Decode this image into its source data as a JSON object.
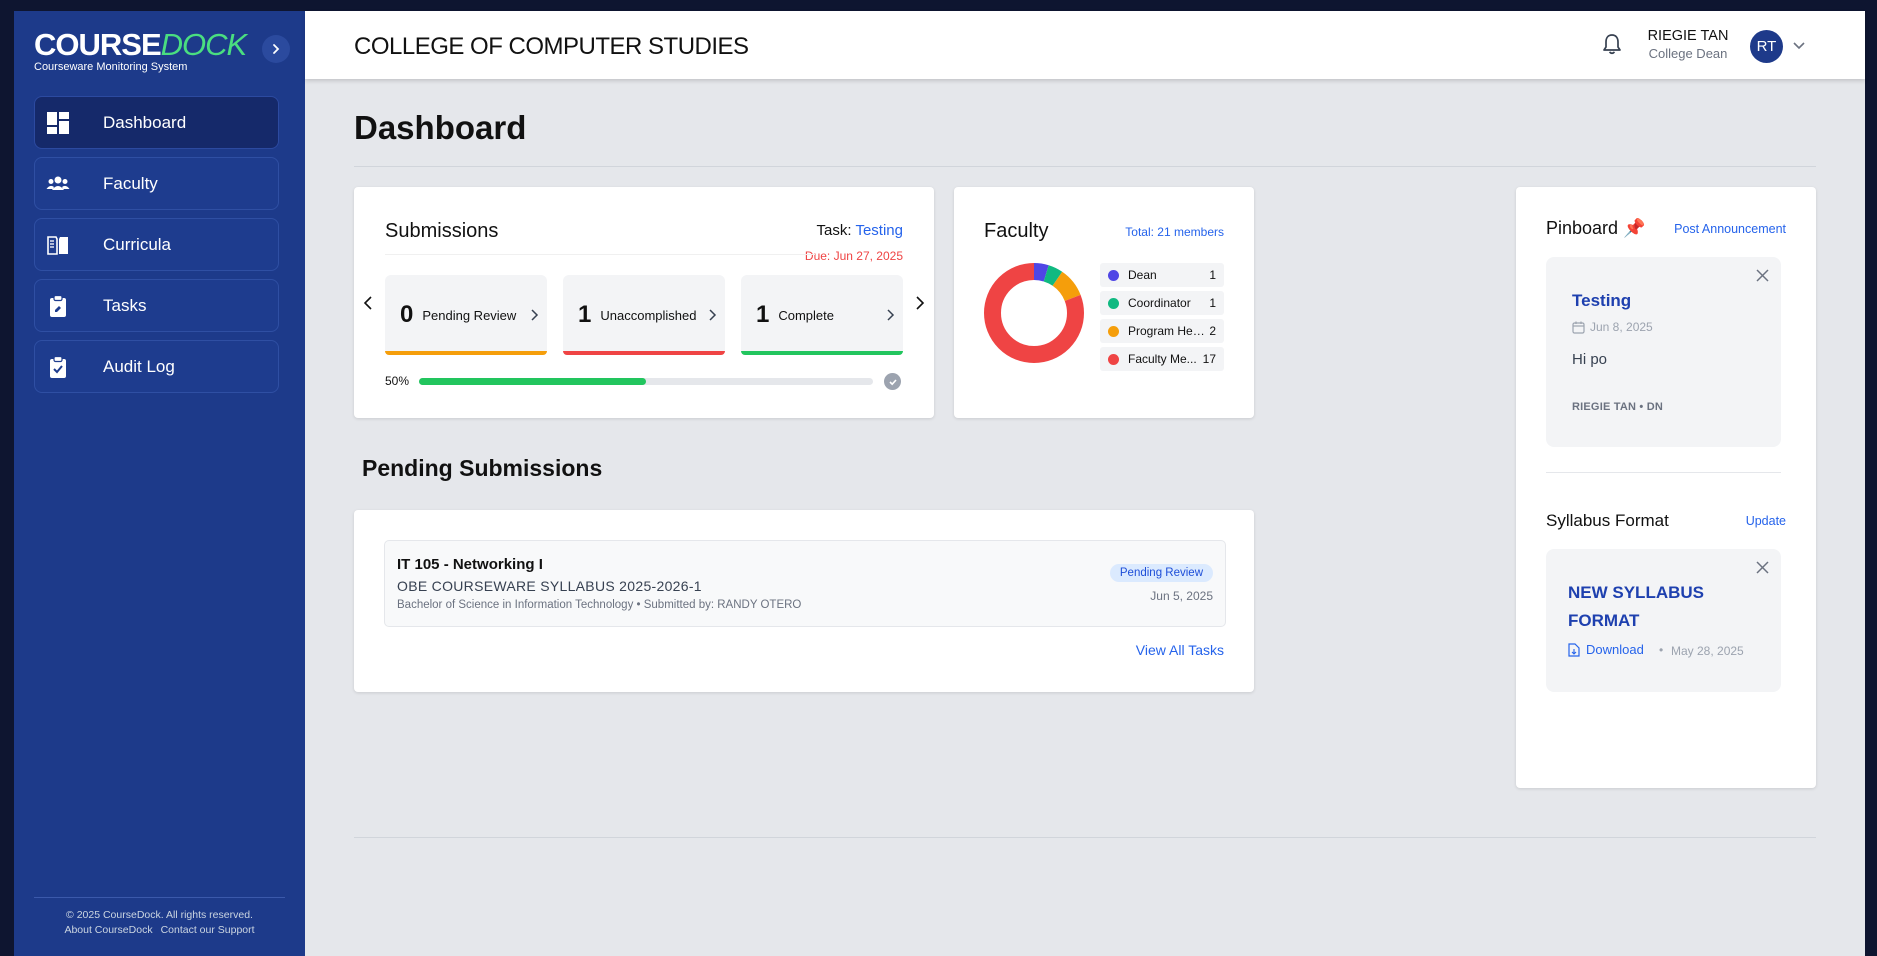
{
  "app": {
    "logo_course": "COURSE",
    "logo_dock": "DOCK",
    "logo_subtitle": "Courseware Monitoring System"
  },
  "sidebar": {
    "items": [
      {
        "label": "Dashboard",
        "icon": "dashboard-icon",
        "active": true
      },
      {
        "label": "Faculty",
        "icon": "users-icon",
        "active": false
      },
      {
        "label": "Curricula",
        "icon": "book-icon",
        "active": false
      },
      {
        "label": "Tasks",
        "icon": "clipboard-icon",
        "active": false
      },
      {
        "label": "Audit Log",
        "icon": "clipboard-check-icon",
        "active": false
      }
    ],
    "footer": {
      "copyright": "© 2025 CourseDock. All rights reserved.",
      "about": "About CourseDock",
      "contact": "Contact our Support"
    }
  },
  "header": {
    "college": "COLLEGE OF COMPUTER STUDIES",
    "user_name": "RIEGIE TAN",
    "user_role": "College Dean",
    "avatar_initials": "RT"
  },
  "page": {
    "title": "Dashboard"
  },
  "submissions": {
    "title": "Submissions",
    "task_label": "Task:",
    "task_value": "Testing",
    "due": "Due: Jun 27, 2025",
    "stats": [
      {
        "count": "0",
        "label": "Pending Review",
        "color": "#f59e0b"
      },
      {
        "count": "1",
        "label": "Unaccomplished",
        "color": "#ef4444"
      },
      {
        "count": "1",
        "label": "Complete",
        "color": "#22c55e"
      }
    ],
    "progress_label": "50%",
    "progress": 0.5
  },
  "faculty": {
    "title": "Faculty",
    "total": "Total: 21 members",
    "legend": [
      {
        "name": "Dean",
        "value": "1",
        "color": "#4f46e5"
      },
      {
        "name": "Coordinator",
        "value": "1",
        "color": "#10b981"
      },
      {
        "name": "Program Head",
        "value": "2",
        "color": "#f59e0b"
      },
      {
        "name": "Faculty Me...",
        "value": "17",
        "color": "#ef4444"
      }
    ]
  },
  "pending": {
    "heading": "Pending Submissions",
    "items": [
      {
        "course": "IT 105 - Networking I",
        "document": "OBE COURSEWARE SYLLABUS 2025-2026-1",
        "meta": "Bachelor of Science in Information Technology • Submitted by: RANDY OTERO",
        "status": "Pending Review",
        "date": "Jun 5, 2025"
      }
    ],
    "view_all": "View All Tasks"
  },
  "pinboard": {
    "title": "Pinboard",
    "pin_emoji": "📌",
    "post_label": "Post Announcement",
    "announcement": {
      "title": "Testing",
      "date": "Jun 8, 2025",
      "body": "Hi po",
      "author": "RIEGIE TAN • DN"
    }
  },
  "syllabus": {
    "title": "Syllabus Format",
    "update_label": "Update",
    "name": "NEW SYLLABUS FORMAT",
    "download_label": "Download",
    "separator": "•",
    "date": "May 28, 2025"
  }
}
